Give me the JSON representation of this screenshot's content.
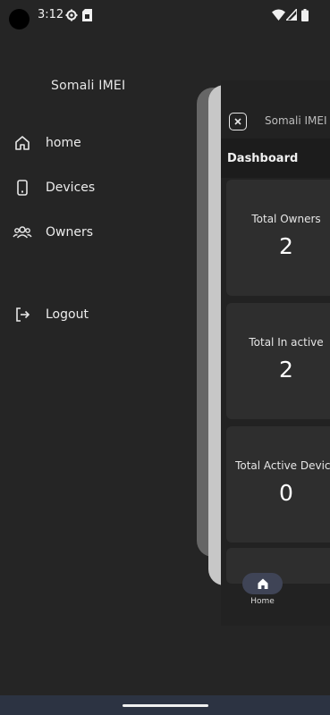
{
  "status_bar": {
    "time": "3:12",
    "icons": [
      "settings-gear-icon",
      "sim-card-icon",
      "wifi-icon",
      "cell-signal-icon",
      "battery-icon"
    ]
  },
  "drawer": {
    "title": "Somali IMEI",
    "items": [
      {
        "label": "home",
        "icon": "home-icon"
      },
      {
        "label": "Devices",
        "icon": "phone-icon"
      },
      {
        "label": "Owners",
        "icon": "group-icon"
      },
      {
        "label": "Logout",
        "icon": "logout-icon"
      }
    ]
  },
  "screen": {
    "app_title": "Somali IMEI",
    "section_title": "Dashboard",
    "cards": [
      {
        "label": "Total Owners",
        "value": "2"
      },
      {
        "label": "Total In active",
        "value": "2"
      },
      {
        "label": "Total Active Device",
        "value": "0"
      }
    ],
    "bottom_nav": {
      "home_label": "Home"
    }
  },
  "colors": {
    "background": "#252525",
    "card": "#2e2e2e",
    "nav_active": "#3f4456",
    "gesture_bar": "#2c3342"
  }
}
